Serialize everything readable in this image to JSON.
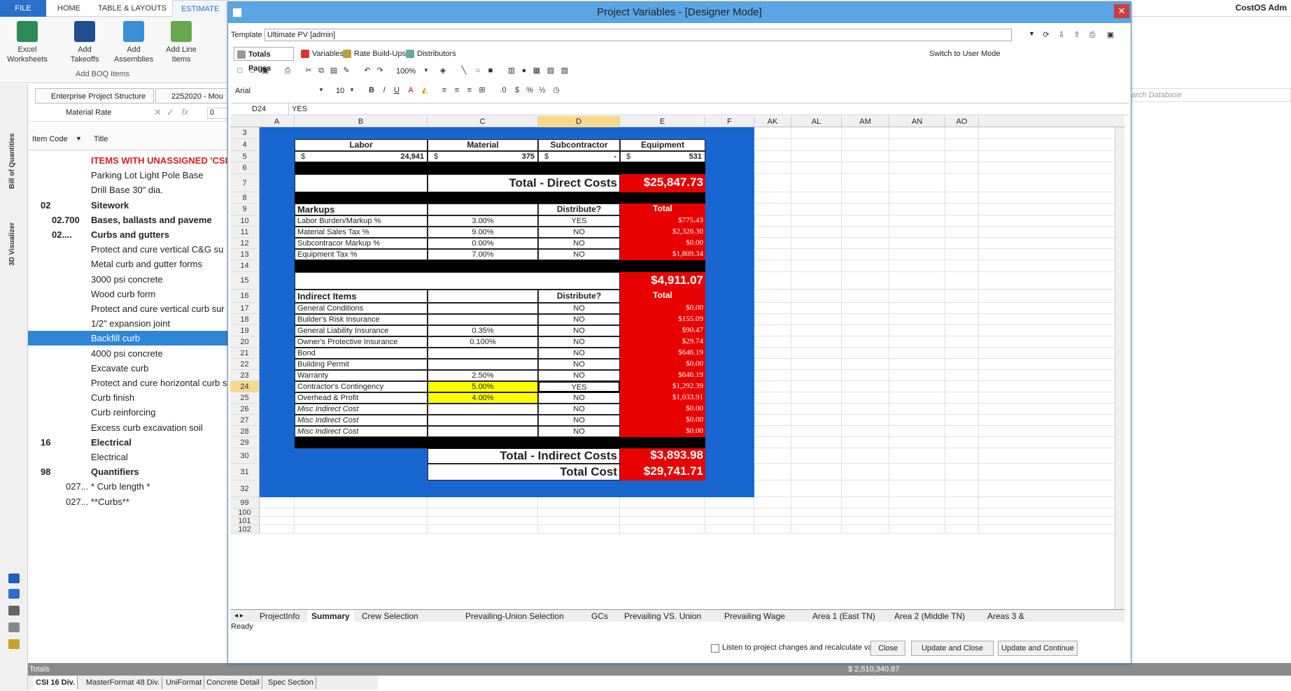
{
  "ribbon": {
    "tabs": [
      "FILE",
      "HOME",
      "TABLE & LAYOUTS",
      "ESTIMATE"
    ],
    "buttons": [
      {
        "label": "Excel\nWorksheets"
      },
      {
        "label": "Add\nTakeoffs"
      },
      {
        "label": "Add\nAssemblies"
      },
      {
        "label": "Add Line\nItems"
      }
    ],
    "group_label": "Add BOQ Items",
    "user": "CostOS Adm",
    "search_placeholder": "arch Database"
  },
  "left_panel": {
    "tabs": [
      "Enterprise Project Structure",
      "2252020 - Mou"
    ],
    "formula_label": "Material Rate",
    "formula_value": "0",
    "col_item_code": "Item Code",
    "col_title": "Title",
    "vertical_labels": [
      "Bill of Quantities",
      "3D Visualizer"
    ],
    "rows": [
      {
        "code": "",
        "title": "ITEMS WITH UNASSIGNED 'CSI 16 I",
        "style": "red"
      },
      {
        "code": "",
        "title": "Parking Lot Light Pole Base",
        "style": ""
      },
      {
        "code": "",
        "title": "Drill Base 30\" dia.",
        "style": ""
      },
      {
        "code": "02",
        "title": "Sitework",
        "style": "bold"
      },
      {
        "code": "02.700",
        "title": "Bases, ballasts and paveme",
        "style": "bold"
      },
      {
        "code": "02....",
        "title": "Curbs and gutters",
        "style": "bold"
      },
      {
        "code": "",
        "title": "Protect and cure vertical C&G su",
        "style": ""
      },
      {
        "code": "",
        "title": "Metal curb and gutter forms",
        "style": ""
      },
      {
        "code": "",
        "title": "3000 psi concrete",
        "style": ""
      },
      {
        "code": "",
        "title": "Wood curb form",
        "style": ""
      },
      {
        "code": "",
        "title": "Protect and cure vertical curb sur",
        "style": ""
      },
      {
        "code": "",
        "title": "1/2\" expansion joint",
        "style": ""
      },
      {
        "code": "",
        "title": "Backfill curb",
        "style": "sel"
      },
      {
        "code": "",
        "title": "4000 psi concrete",
        "style": ""
      },
      {
        "code": "",
        "title": "Excavate curb",
        "style": ""
      },
      {
        "code": "",
        "title": "Protect and cure horizontal curb s",
        "style": ""
      },
      {
        "code": "",
        "title": "Curb finish",
        "style": ""
      },
      {
        "code": "",
        "title": "Curb reinforcing",
        "style": ""
      },
      {
        "code": "",
        "title": "Excess curb excavation soil",
        "style": ""
      },
      {
        "code": "16",
        "title": "Electrical",
        "style": "bold"
      },
      {
        "code": "",
        "title": "Electrical",
        "style": ""
      },
      {
        "code": "98",
        "title": "Quantifiers",
        "style": "bold"
      },
      {
        "code": "027...",
        "title": "* Curb length *",
        "style": ""
      },
      {
        "code": "027...",
        "title": "**Curbs**",
        "style": ""
      }
    ],
    "totals_label": "Totals",
    "totals_value": "$ 2,510,340.87",
    "bottom_tabs": [
      "CSI 16 Div.",
      "MasterFormat 48 Div.",
      "UniFormat",
      "Concrete Detail",
      "Spec Section"
    ]
  },
  "dialog": {
    "title": "Project Variables - [Designer Mode]",
    "template_label": "Template",
    "template_value": "Ultimate PV [admin]",
    "toolbar_tabs": [
      "Totals Pages",
      "Variables",
      "Rate Build-Ups",
      "Distributors"
    ],
    "switch_mode": "Switch to User Mode",
    "zoom": "100%",
    "font_name": "Arial",
    "font_size": "10",
    "cell_ref": "D24",
    "cell_value": "YES",
    "status": "Ready",
    "recalc_label": "Listen to project changes and recalculate variables",
    "buttons": [
      "Close",
      "Update and Close",
      "Update and Continue"
    ],
    "sheet_tabs": [
      "ProjectInfo",
      "Summary",
      "Crew Selection",
      "Prevailing-Union Selection",
      "GCs",
      "Prevailing VS. Union",
      "Prevailing Wage",
      "Area 1 (East TN)",
      "Area 2 (Middle TN)",
      "Areas 3 &"
    ]
  },
  "sheet": {
    "columns": [
      "A",
      "B",
      "C",
      "D",
      "E",
      "F",
      "AK",
      "AL",
      "AM",
      "AN",
      "AO"
    ],
    "row_numbers": [
      "3",
      "4",
      "5",
      "6",
      "7",
      "8",
      "9",
      "10",
      "11",
      "12",
      "13",
      "14",
      "15",
      "16",
      "17",
      "18",
      "19",
      "20",
      "21",
      "22",
      "23",
      "24",
      "25",
      "26",
      "27",
      "28",
      "29",
      "30",
      "31",
      "32",
      "99",
      "100",
      "101",
      "102"
    ],
    "top_headers": [
      "Labor",
      "Material",
      "Subcontractor",
      "Equipment"
    ],
    "top_values": [
      {
        "cur": "$",
        "val": "24,941"
      },
      {
        "cur": "$",
        "val": "375"
      },
      {
        "cur": "$",
        "val": "-"
      },
      {
        "cur": "$",
        "val": "531"
      }
    ],
    "direct_label": "Total - Direct Costs",
    "direct_value": "$25,847.73",
    "markups_label": "Markups",
    "distribute_label": "Distribute?",
    "total_label": "Total",
    "markups": [
      {
        "name": "Labor Burden/Markup %",
        "pct": "3.00%",
        "dist": "YES",
        "total": "$775.43"
      },
      {
        "name": "Material Sales Tax %",
        "pct": "9.00%",
        "dist": "NO",
        "total": "$2,326.30"
      },
      {
        "name": "Subcontracor Markup %",
        "pct": "0.00%",
        "dist": "NO",
        "total": "$0.00"
      },
      {
        "name": "Equipment Tax %",
        "pct": "7.00%",
        "dist": "NO",
        "total": "$1,809.34"
      }
    ],
    "markups_total": "$4,911.07",
    "indirect_label": "Indirect Items",
    "indirect": [
      {
        "name": "General Conditions",
        "pct": "",
        "dist": "NO",
        "total": "$0.00",
        "yellow": false,
        "italic": false
      },
      {
        "name": "Builder's Risk Insurance",
        "pct": "",
        "dist": "NO",
        "total": "$155.09",
        "yellow": false,
        "italic": false
      },
      {
        "name": "General Liability Insurance",
        "pct": "0.35%",
        "dist": "NO",
        "total": "$90.47",
        "yellow": false,
        "italic": false
      },
      {
        "name": "Owner's Protective Insurance",
        "pct": "0.100%",
        "dist": "NO",
        "total": "$29.74",
        "yellow": false,
        "italic": false
      },
      {
        "name": "Bond",
        "pct": "",
        "dist": "NO",
        "total": "$646.19",
        "yellow": false,
        "italic": false
      },
      {
        "name": "Building Permit",
        "pct": "",
        "dist": "NO",
        "total": "$0.00",
        "yellow": false,
        "italic": false
      },
      {
        "name": "Warranty",
        "pct": "2.50%",
        "dist": "NO",
        "total": "$646.19",
        "yellow": false,
        "italic": false
      },
      {
        "name": "Contractor's Contingency",
        "pct": "5.00%",
        "dist": "YES",
        "total": "$1,292.39",
        "yellow": true,
        "italic": false
      },
      {
        "name": "Overhead & Profit",
        "pct": "4.00%",
        "dist": "NO",
        "total": "$1,033.91",
        "yellow": true,
        "italic": false
      },
      {
        "name": "Misc Indirect Cost",
        "pct": "",
        "dist": "NO",
        "total": "$0.00",
        "yellow": false,
        "italic": true
      },
      {
        "name": "Misc Indirect Cost",
        "pct": "",
        "dist": "NO",
        "total": "$0.00",
        "yellow": false,
        "italic": true
      },
      {
        "name": "Misc Indirect Cost",
        "pct": "",
        "dist": "NO",
        "total": "$0.00",
        "yellow": false,
        "italic": true
      }
    ],
    "indirect_total_label": "Total - Indirect Costs",
    "indirect_total_value": "$3,893.98",
    "total_cost_label": "Total Cost",
    "total_cost_value": "$29,741.71"
  }
}
